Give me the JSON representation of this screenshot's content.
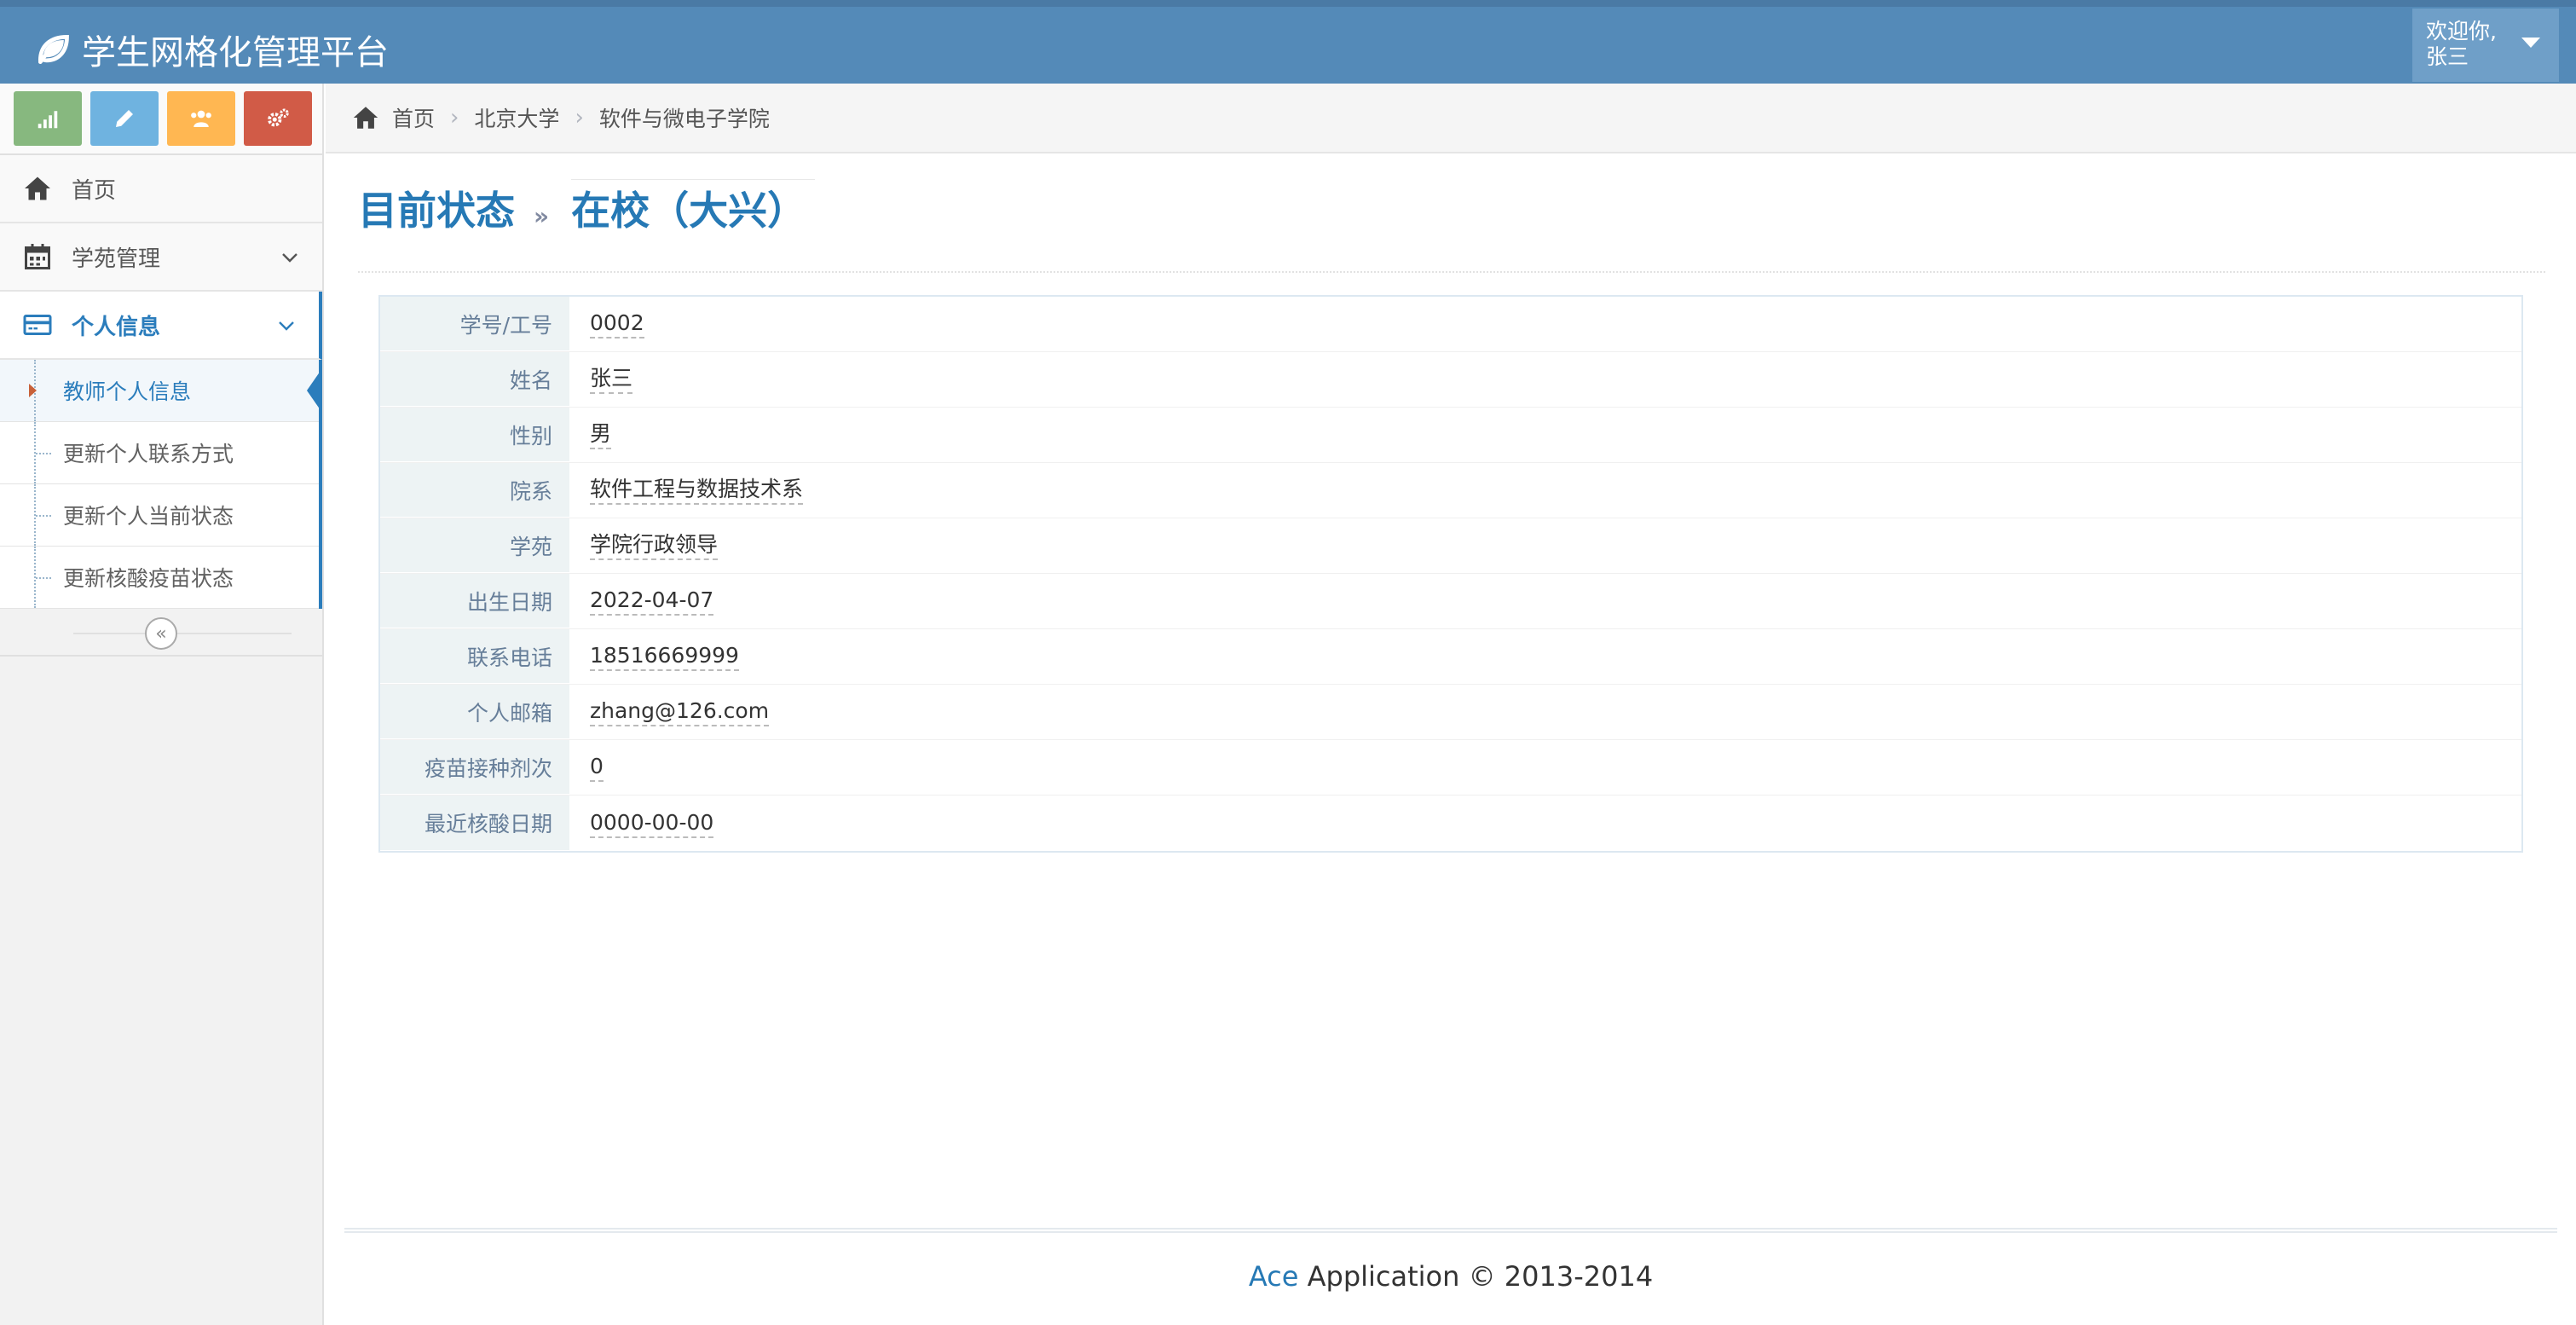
{
  "app": {
    "title": "学生网格化管理平台"
  },
  "user": {
    "welcome": "欢迎你,",
    "name": "张三"
  },
  "shortcuts": [
    {
      "icon": "signal-icon",
      "color": "#87b87f"
    },
    {
      "icon": "pencil-icon",
      "color": "#6fb3e0"
    },
    {
      "icon": "users-icon",
      "color": "#ffb752"
    },
    {
      "icon": "cogs-icon",
      "color": "#d15b47"
    }
  ],
  "sidebar": {
    "items": [
      {
        "label": "首页",
        "icon": "home-icon"
      },
      {
        "label": "学苑管理",
        "icon": "calendar-icon"
      },
      {
        "label": "个人信息",
        "icon": "credit-card-icon",
        "active": true
      }
    ],
    "submenu": [
      {
        "label": "教师个人信息",
        "active": true
      },
      {
        "label": "更新个人联系方式"
      },
      {
        "label": "更新个人当前状态"
      },
      {
        "label": "更新核酸疫苗状态"
      }
    ]
  },
  "breadcrumbs": [
    "首页",
    "北京大学",
    "软件与微电子学院"
  ],
  "page": {
    "title": "目前状态",
    "separator": "»",
    "status": "在校（大兴）"
  },
  "profile": [
    {
      "label": "学号/工号",
      "value": "0002"
    },
    {
      "label": "姓名",
      "value": "张三"
    },
    {
      "label": "性别",
      "value": "男"
    },
    {
      "label": "院系",
      "value": "软件工程与数据技术系"
    },
    {
      "label": "学苑",
      "value": "学院行政领导"
    },
    {
      "label": "出生日期",
      "value": "2022-04-07"
    },
    {
      "label": "联系电话",
      "value": "18516669999"
    },
    {
      "label": "个人邮箱",
      "value": "zhang@126.com"
    },
    {
      "label": "疫苗接种剂次",
      "value": "0"
    },
    {
      "label": "最近核酸日期",
      "value": "0000-00-00"
    }
  ],
  "footer": {
    "brand": "Ace",
    "text": " Application © 2013-2014"
  },
  "colors": {
    "navbar": "#548ab8",
    "accent": "#2679b5"
  }
}
